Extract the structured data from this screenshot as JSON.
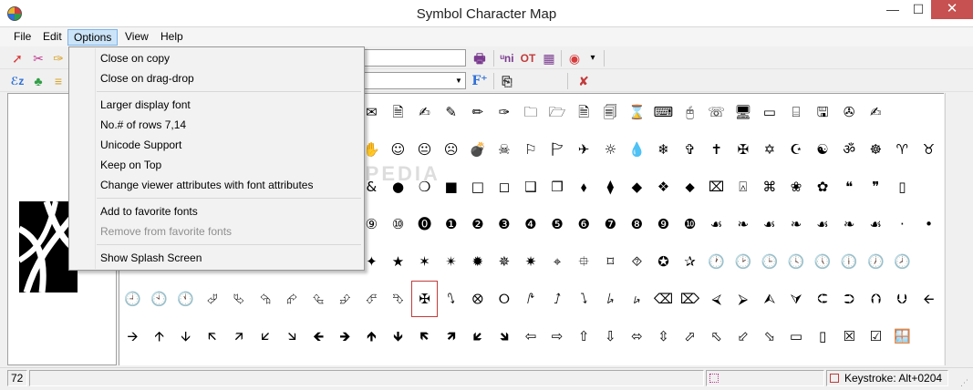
{
  "window": {
    "title": "Symbol Character Map",
    "minimize": "—",
    "maximize": "☐",
    "close": "✕"
  },
  "menubar": {
    "items": [
      {
        "label": "File",
        "name": "menu-file"
      },
      {
        "label": "Edit",
        "name": "menu-edit"
      },
      {
        "label": "Options",
        "name": "menu-options"
      },
      {
        "label": "View",
        "name": "menu-view"
      },
      {
        "label": "Help",
        "name": "menu-help"
      }
    ]
  },
  "toolbar": {
    "row1_left": [
      "➚",
      "✂",
      "✑"
    ],
    "row1_right": [
      {
        "glyph": "🖶",
        "name": "copy-table-icon",
        "color": "#7a3b8f"
      },
      {
        "glyph": "ᵘni",
        "name": "unicode-button-icon",
        "color": "#7a3b8f"
      },
      {
        "glyph": "OT",
        "name": "opentype-button-icon",
        "color": "#c23b3b"
      },
      {
        "glyph": "▦",
        "name": "grid-view-icon",
        "color": "#7a3b8f"
      },
      {
        "glyph": "◉",
        "name": "color-picker-icon",
        "color": "#d83b3b"
      },
      {
        "glyph": "▾",
        "name": "color-dropdown-arrow-icon",
        "color": "#000000"
      }
    ],
    "row2_left": [
      "ℰz",
      "♣",
      "≡"
    ],
    "row2_right": [
      {
        "glyph": "F⁺",
        "name": "font-size-increase-icon",
        "color": "#2e6fd8"
      },
      {
        "glyph": "⎘",
        "name": "copy-icon",
        "color": "#333333"
      },
      {
        "glyph": "✘",
        "name": "clear-icon",
        "color": "#c23b3b"
      }
    ]
  },
  "options_menu": {
    "items": [
      {
        "label": "Close on copy",
        "disabled": false
      },
      {
        "label": "Close on drag-drop",
        "disabled": false
      },
      {
        "label": "Larger display font",
        "disabled": false
      },
      {
        "label": "No.# of rows 7,14",
        "disabled": false
      },
      {
        "label": "Unicode Support",
        "disabled": false
      },
      {
        "label": "Keep on Top",
        "disabled": false
      },
      {
        "label": "Change viewer attributes with font attributes",
        "disabled": false
      },
      {
        "label": "Add to favorite fonts",
        "disabled": false
      },
      {
        "label": "Remove from favorite fonts",
        "disabled": true
      },
      {
        "label": "Show Splash Screen",
        "disabled": false
      }
    ]
  },
  "grid": {
    "rows": [
      [
        "",
        "",
        "",
        "",
        "",
        "",
        "",
        "",
        "",
        "✉",
        "🗎",
        "✍",
        "✎",
        "✏",
        "✑",
        "🗀",
        "🗁",
        "🗎",
        "🗐",
        "⌛",
        "⌨",
        "🖰",
        "☏",
        "🖥",
        "▭",
        "⌸",
        "🖫",
        "✇",
        "✍"
      ],
      [
        "",
        "",
        "",
        "",
        "",
        "",
        "",
        "",
        "",
        "✋",
        "☺",
        "😐",
        "☹",
        "💣",
        "☠",
        "⚐",
        "🏱",
        "✈",
        "☼",
        "💧",
        "❄",
        "✞",
        "✝",
        "✠",
        "✡",
        "☪",
        "☯",
        "ॐ",
        "☸",
        "♈",
        "♉"
      ],
      [
        "",
        "",
        "",
        "",
        "",
        "",
        "",
        "",
        "",
        "&",
        "●",
        "❍",
        "■",
        "□",
        "◻",
        "❑",
        "❒",
        "⬧",
        "⧫",
        "◆",
        "❖",
        "⬥",
        "⌧",
        "⍓",
        "⌘",
        "❀",
        "✿",
        "❝",
        "❞",
        "▯"
      ],
      [
        "",
        "",
        "",
        "",
        "",
        "",
        "",
        "",
        "",
        "⑨",
        "⑩",
        "⓿",
        "❶",
        "❷",
        "❸",
        "❹",
        "❺",
        "❻",
        "❼",
        "❽",
        "❾",
        "❿",
        "☙",
        "❧",
        "☙",
        "❧",
        "☙",
        "❧",
        "☙",
        "·",
        "•"
      ],
      [
        "",
        "",
        "",
        "",
        "",
        "",
        "",
        "",
        "",
        "✦",
        "★",
        "✶",
        "✴",
        "✹",
        "✵",
        "✷",
        "⌖",
        "⯐",
        "⌑",
        "⯑",
        "✪",
        "✰",
        "🕐",
        "🕑",
        "🕒",
        "🕓",
        "🕔",
        "🕕",
        "🕖",
        "🕗"
      ],
      [
        "🕘",
        "🕙",
        "🕚",
        "⮰",
        "⮱",
        "⮲",
        "⮳",
        "⮴",
        "⮵",
        "⮶",
        "⮷",
        "✠",
        "⭛",
        "⭙",
        "⭘",
        "⭚",
        "⭜",
        "⭝",
        "⭞",
        "⭟",
        "⌫",
        "⌦",
        "⮘",
        "⮚",
        "⮙",
        "⮛",
        "⮈",
        "⮊",
        "⮉",
        "⮋",
        "🡨"
      ],
      [
        "🡪",
        "🡩",
        "🡫",
        "🡬",
        "🡭",
        "🡯",
        "🡮",
        "🡸",
        "🡺",
        "🡹",
        "🡻",
        "🡼",
        "🡽",
        "🡿",
        "🡾",
        "⇦",
        "⇨",
        "⇧",
        "⇩",
        "⬄",
        "⇳",
        "⬀",
        "⬁",
        "⬃",
        "⬂",
        "▭",
        "▯",
        "☒",
        "☑",
        "🪟"
      ]
    ],
    "selected": "✠"
  },
  "statusbar": {
    "code": "72",
    "keystroke": "Keystroke: Alt+0204"
  },
  "watermark": "SOFTPEDIA"
}
